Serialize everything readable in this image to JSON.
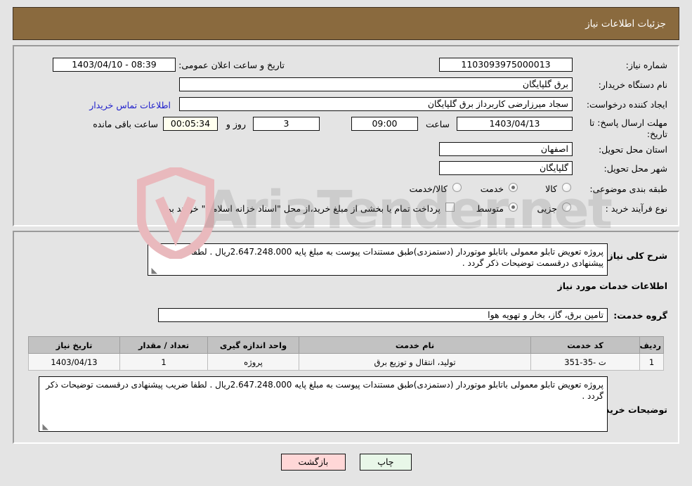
{
  "header": {
    "title": "جزئیات اطلاعات نیاز",
    "bg_color": "#8a6a3e",
    "text_color": "#ffffff"
  },
  "watermark": {
    "text": "AriaTender.net",
    "shield_color": "#e8b7bb"
  },
  "form": {
    "need_number_label": "شماره نیاز:",
    "need_number_value": "1103093975000013",
    "announce_label": "تاریخ و ساعت اعلان عمومی:",
    "announce_value": "1403/04/10 - 08:39",
    "buyer_org_label": "نام دستگاه خریدار:",
    "buyer_org_value": "برق گلپایگان",
    "requester_label": "ایجاد کننده درخواست:",
    "requester_value": "سجاد میرزارضی کاربرداز برق گلپایگان",
    "contact_link": "اطلاعات تماس خریدار",
    "deadline_label_line1": "مهلت ارسال پاسخ: تا",
    "deadline_label_line2": "تاریخ:",
    "deadline_date": "1403/04/13",
    "deadline_time_label": "ساعت",
    "deadline_time": "09:00",
    "remaining_days": "3",
    "remaining_days_label": "روز و",
    "remaining_clock": "00:05:34",
    "remaining_clock_label": "ساعت باقی مانده",
    "province_label": "استان محل تحویل:",
    "province_value": "اصفهان",
    "city_label": "شهر محل تحویل:",
    "city_value": "گلپایگان",
    "category_label": "طبقه بندی موضوعی:",
    "category_options": [
      "کالا",
      "خدمت",
      "کالا/خدمت"
    ],
    "category_selected": "خدمت",
    "process_label": "نوع فرآیند خرید :",
    "process_options": [
      "جزیی",
      "متوسط"
    ],
    "process_selected": "متوسط",
    "treasury_checkbox_label": "پرداخت تمام یا بخشی از مبلغ خرید،از محل \"اسناد خزانه اسلامی\" خواهد بود.",
    "treasury_checked": false
  },
  "description": {
    "summary_label": "شرح کلی نیاز:",
    "summary_value": "پروژه تعویض تابلو معمولی باتابلو موتوردار (دستمزدی)طبق مستندات پیوست به مبلغ پایه 2.647.248.000ریال . لطفا ضریب پیشنهادی درقسمت توضیحات ذکر گردد .",
    "services_heading": "اطلاعات خدمات مورد نیاز",
    "service_group_label": "گروه خدمت:",
    "service_group_value": "تامین برق، گاز، بخار و تهویه هوا",
    "buyer_notes_label": "توضیحات خریدار:",
    "buyer_notes_value": "پروژه تعویض تابلو معمولی باتابلو موتوردار (دستمزدی)طبق مستندات پیوست به مبلغ پایه 2.647.248.000ریال . لطفا ضریب پیشنهادی درقسمت توضیحات ذکر گردد ."
  },
  "services_table": {
    "columns": [
      "ردیف",
      "کد خدمت",
      "نام خدمت",
      "واحد اندازه گیری",
      "تعداد / مقدار",
      "تاریخ نیاز"
    ],
    "rows": [
      {
        "row_no": "1",
        "code": "ت -35-351",
        "name": "تولید، انتقال و توزیع برق",
        "unit": "پروژه",
        "qty": "1",
        "need_date": "1403/04/13"
      }
    ]
  },
  "footer": {
    "print_label": "چاپ",
    "back_label": "بازگشت"
  }
}
